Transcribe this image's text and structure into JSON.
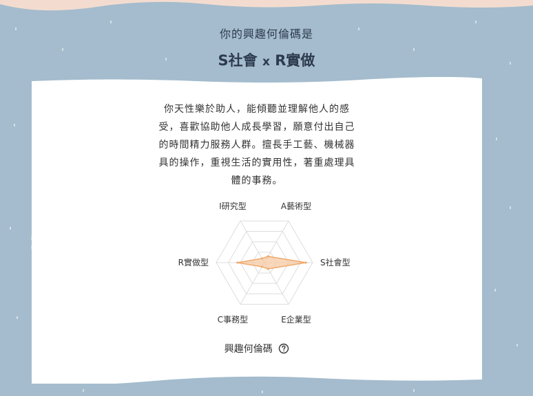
{
  "header": {
    "subtitle": "你的興趣何倫碼是",
    "code_left": "S社會",
    "code_x": "x",
    "code_right": "R實做"
  },
  "description": [
    "你天性樂於助人，能傾聽並理解他人的感",
    "受，喜歡協助他人成長學習，願意付出自己",
    "的時間精力服務人群。擅長手工藝、機械器",
    "具的操作，重視生活的實用性，著重處理具",
    "體的事務。"
  ],
  "legend": {
    "label": "興趣何倫碼",
    "icon": "question-circle-icon"
  },
  "colors": {
    "background": "#a4bccd",
    "card": "#ffffff",
    "accent": "#f0a868",
    "fill": "#f6c9a3",
    "top_band": "#f3dccf"
  },
  "chart_data": {
    "type": "radar",
    "axes": [
      "I研究型",
      "A藝術型",
      "S社會型",
      "E企業型",
      "C事務型",
      "R實做型"
    ],
    "values": [
      0.1,
      0.15,
      0.86,
      0.15,
      0.1,
      0.56
    ],
    "range": [
      0,
      1
    ],
    "grid_levels": 4
  }
}
